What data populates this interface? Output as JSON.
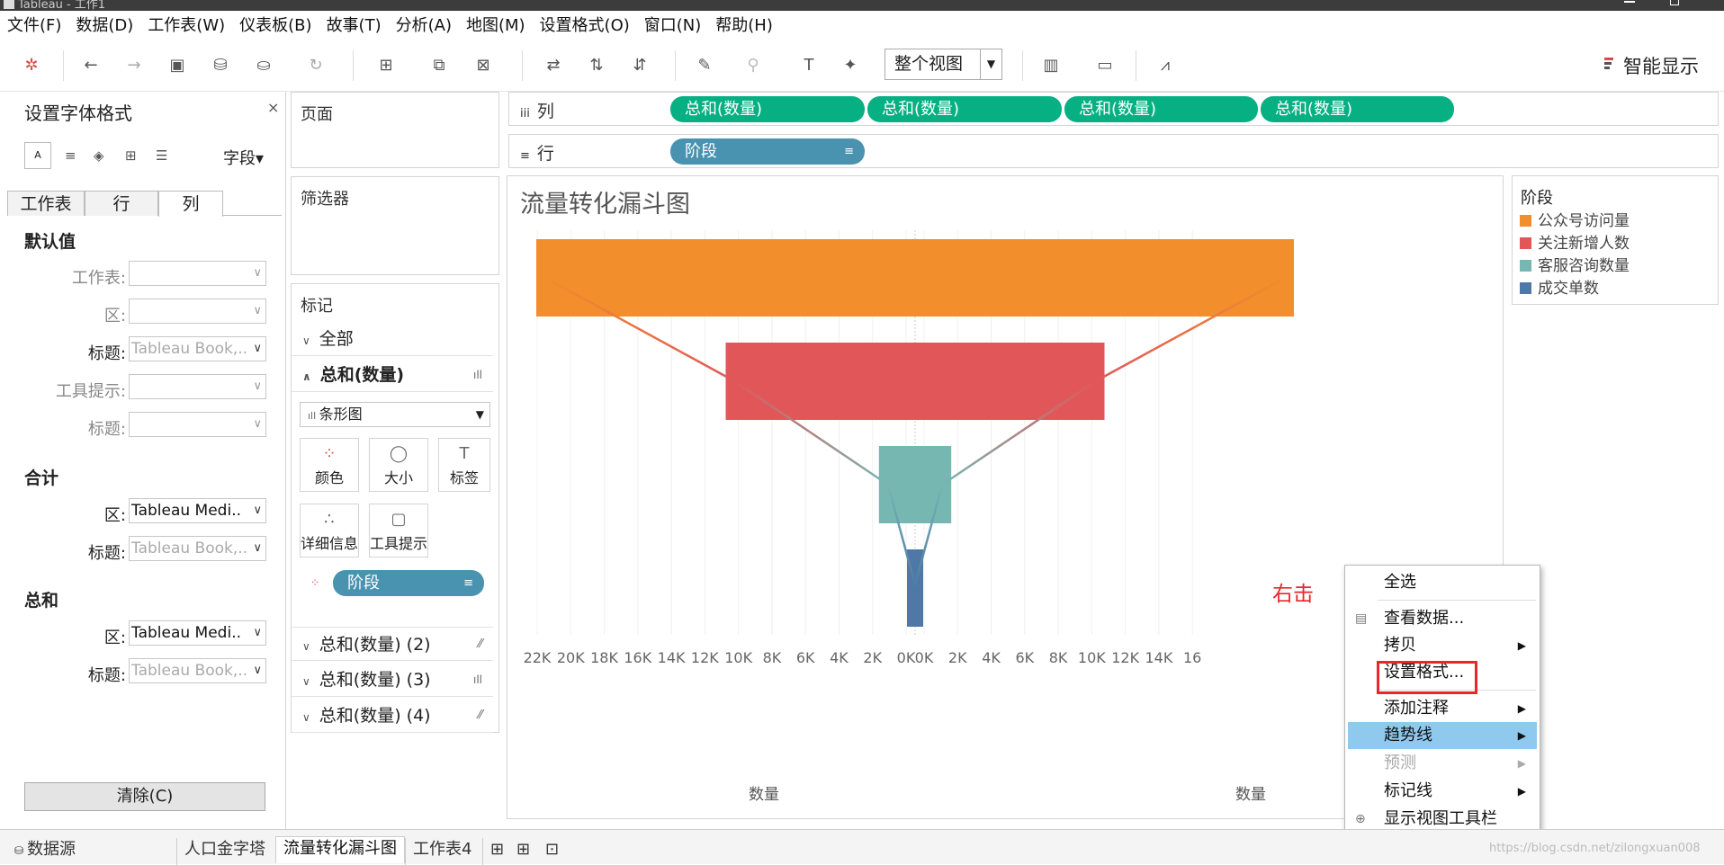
{
  "window": {
    "title": "Tableau - 工作1"
  },
  "menu": [
    "文件(F)",
    "数据(D)",
    "工作表(W)",
    "仪表板(B)",
    "故事(T)",
    "分析(A)",
    "地图(M)",
    "设置格式(O)",
    "窗口(N)",
    "帮助(H)"
  ],
  "toolbar": {
    "fit_label": "整个视图",
    "smart_label": "智能显示"
  },
  "format_pane": {
    "title": "设置字体格式",
    "field_label": "字段",
    "tabs": [
      "工作表",
      "行",
      "列"
    ],
    "default_section": "默认值",
    "total_section": "合计",
    "sum_section": "总和",
    "rows_default": [
      {
        "label": "工作表:",
        "value": ""
      },
      {
        "label": "区:",
        "value": ""
      },
      {
        "label": "标题:",
        "value": "Tableau Book,.."
      },
      {
        "label": "工具提示:",
        "value": ""
      },
      {
        "label": "标题:",
        "value": ""
      }
    ],
    "rows_total": [
      {
        "label": "区:",
        "value": "Tableau Medi.."
      },
      {
        "label": "标题:",
        "value": "Tableau Book,.."
      }
    ],
    "rows_sum": [
      {
        "label": "区:",
        "value": "Tableau Medi.."
      },
      {
        "label": "标题:",
        "value": "Tableau Book,.."
      }
    ],
    "clear_label": "清除(C)"
  },
  "pages_label": "页面",
  "filters_label": "筛选器",
  "marks": {
    "title": "标记",
    "all": "全部",
    "sum1": "总和(数量)",
    "marktype": "条形图",
    "buttons": [
      "颜色",
      "大小",
      "标签",
      "详细信息",
      "工具提示"
    ],
    "pill": "阶段",
    "sum2": "总和(数量) (2)",
    "sum3": "总和(数量) (3)",
    "sum4": "总和(数量) (4)"
  },
  "columns": {
    "label": "列",
    "pills": [
      "总和(数量)",
      "总和(数量)",
      "总和(数量)",
      "总和(数量)"
    ]
  },
  "rows": {
    "label": "行",
    "pill": "阶段"
  },
  "legend": {
    "title": "阶段",
    "items": [
      {
        "name": "公众号访问量",
        "color": "#f28e2b"
      },
      {
        "name": "关注新增人数",
        "color": "#e15759"
      },
      {
        "name": "客服咨询数量",
        "color": "#76b7b2"
      },
      {
        "name": "成交单数",
        "color": "#4e79a7"
      }
    ]
  },
  "chart_data": {
    "type": "bar",
    "title": "流量转化漏斗图",
    "xlabel": "数量",
    "categories": [
      "公众号访问量",
      "关注新增人数",
      "客服咨询数量",
      "成交单数"
    ],
    "values": [
      22000,
      11000,
      2100,
      400
    ],
    "colors": [
      "#f28e2b",
      "#e15759",
      "#76b7b2",
      "#4e79a7"
    ],
    "left_ticks": [
      "22K",
      "20K",
      "18K",
      "16K",
      "14K",
      "12K",
      "10K",
      "8K",
      "6K",
      "4K",
      "2K",
      "0K"
    ],
    "right_ticks": [
      "0K",
      "2K",
      "4K",
      "6K",
      "8K",
      "10K",
      "12K",
      "14K",
      "16"
    ],
    "xlim": [
      0,
      22000
    ]
  },
  "annotation": "右击",
  "context_menu": [
    {
      "label": "全选",
      "submenu": false,
      "disabled": false,
      "highlight": false
    },
    {
      "label": "查看数据...",
      "submenu": false,
      "disabled": false,
      "highlight": false
    },
    {
      "label": "拷贝",
      "submenu": true,
      "disabled": false,
      "highlight": false
    },
    {
      "label": "设置格式...",
      "submenu": false,
      "disabled": false,
      "highlight": false
    },
    {
      "label": "添加注释",
      "submenu": true,
      "disabled": false,
      "highlight": false
    },
    {
      "label": "趋势线",
      "submenu": true,
      "disabled": false,
      "highlight": true
    },
    {
      "label": "预测",
      "submenu": true,
      "disabled": true,
      "highlight": false
    },
    {
      "label": "标记线",
      "submenu": true,
      "disabled": false,
      "highlight": false
    },
    {
      "label": "显示视图工具栏",
      "submenu": false,
      "disabled": false,
      "highlight": false
    }
  ],
  "bottom_tabs": [
    "数据源",
    "人口金字塔",
    "流量转化漏斗图",
    "工作表4"
  ],
  "watermark": "https://blog.csdn.net/zilongxuan008"
}
